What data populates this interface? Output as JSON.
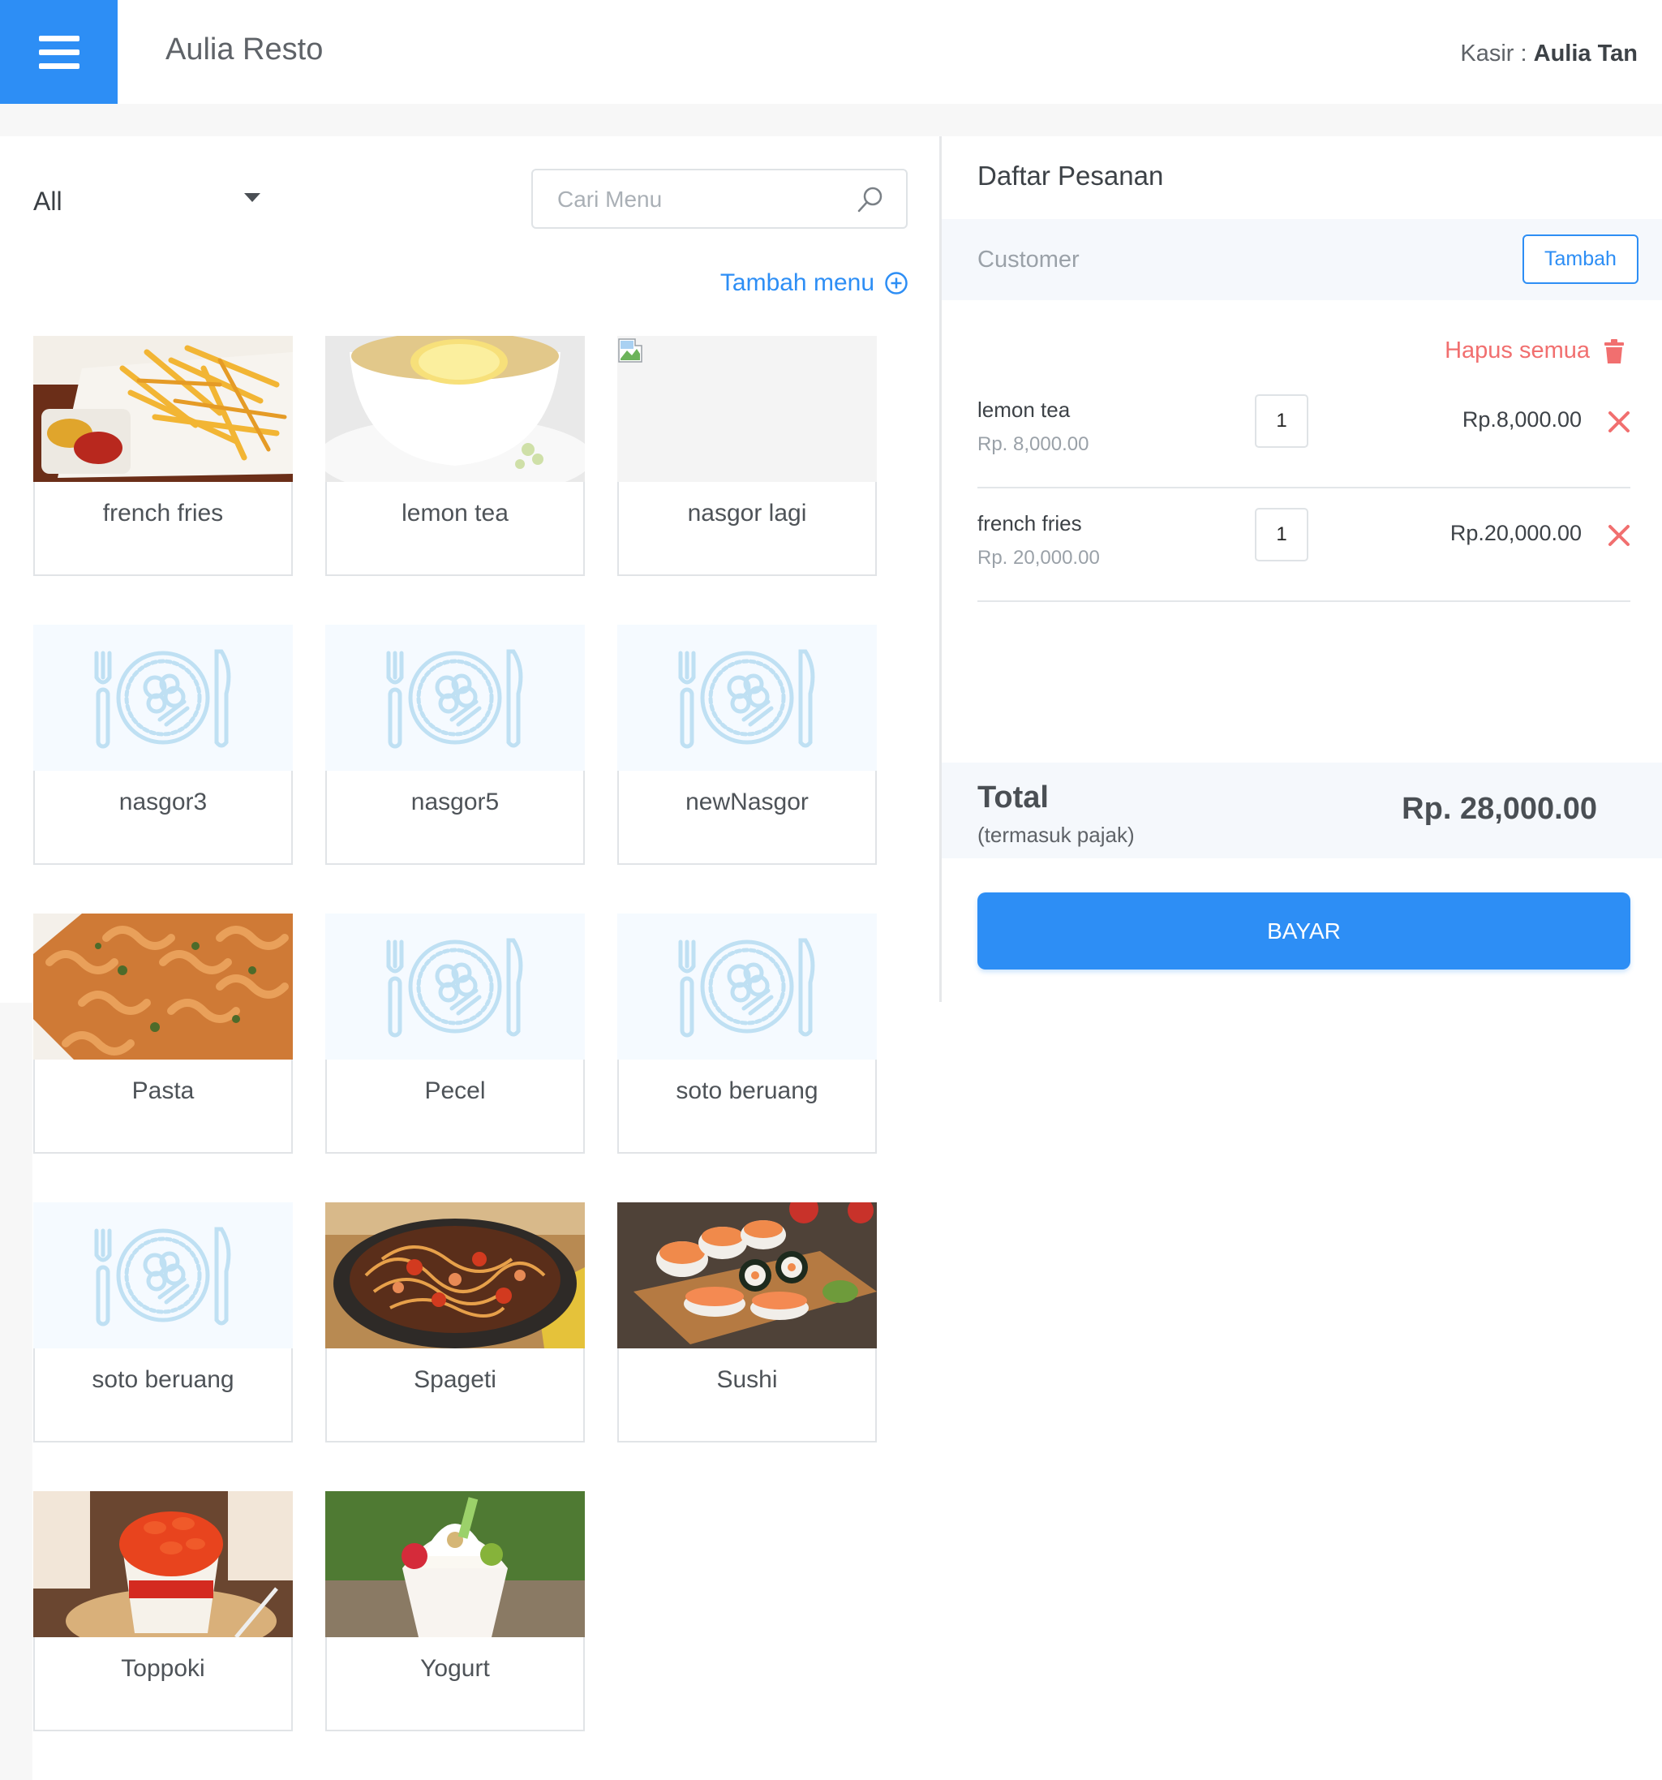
{
  "header": {
    "app_name": "Aulia Resto",
    "cashier_label": "Kasir :",
    "cashier_name": "Aulia Tan"
  },
  "menu": {
    "category_selected": "All",
    "search_placeholder": "Cari Menu",
    "add_menu_label": "Tambah menu",
    "items": [
      {
        "name": "french fries",
        "image": "fries-photo"
      },
      {
        "name": "lemon tea",
        "image": "lemon-tea-photo"
      },
      {
        "name": "nasgor lagi",
        "image": "broken-image"
      },
      {
        "name": "nasgor3",
        "image": "plate-placeholder"
      },
      {
        "name": "nasgor5",
        "image": "plate-placeholder"
      },
      {
        "name": "newNasgor",
        "image": "plate-placeholder"
      },
      {
        "name": "Pasta",
        "image": "pasta-photo"
      },
      {
        "name": "Pecel",
        "image": "plate-placeholder"
      },
      {
        "name": "soto beruang",
        "image": "plate-placeholder"
      },
      {
        "name": "soto beruang",
        "image": "plate-placeholder"
      },
      {
        "name": "Spageti",
        "image": "spaghetti-photo"
      },
      {
        "name": "Sushi",
        "image": "sushi-photo"
      },
      {
        "name": "Toppoki",
        "image": "toppoki-photo"
      },
      {
        "name": "Yogurt",
        "image": "yogurt-photo"
      }
    ]
  },
  "order": {
    "title": "Daftar Pesanan",
    "customer_label": "Customer",
    "add_customer_label": "Tambah",
    "clear_all_label": "Hapus semua",
    "items": [
      {
        "name": "lemon tea",
        "unit_price": "Rp. 8,000.00",
        "qty": "1",
        "subtotal": "Rp.8,000.00"
      },
      {
        "name": "french fries",
        "unit_price": "Rp. 20,000.00",
        "qty": "1",
        "subtotal": "Rp.20,000.00"
      }
    ],
    "total_label": "Total",
    "total_note": "(termasuk pajak)",
    "total_value": "Rp. 28,000.00",
    "pay_label": "BAYAR"
  },
  "colors": {
    "primary": "#2d8ef5",
    "danger": "#f16f6f",
    "panel_bg": "#f5f8fc"
  }
}
